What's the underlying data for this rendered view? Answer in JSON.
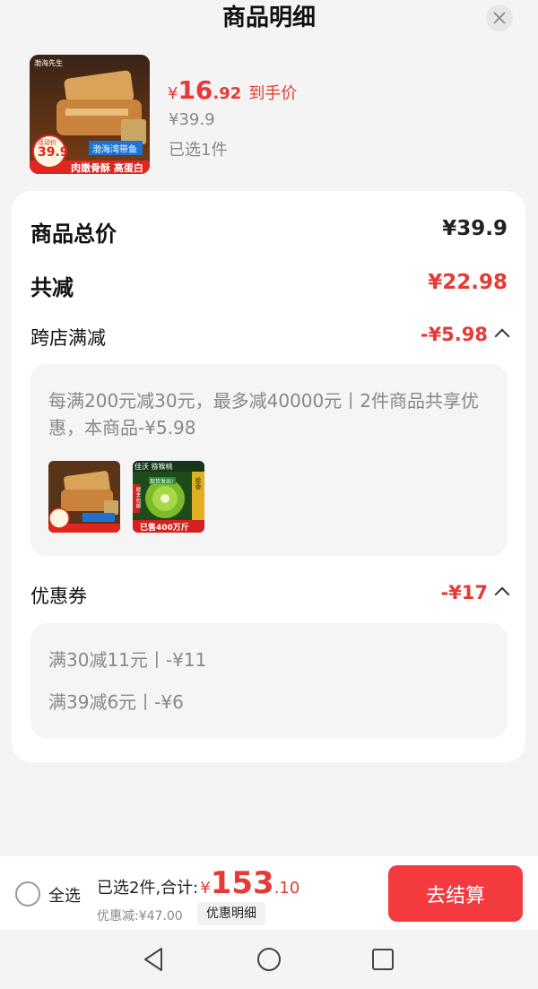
{
  "header": {
    "title": "商品明细"
  },
  "product": {
    "price_currency": "¥",
    "price_int": "16",
    "price_dec": ".92",
    "price_tag": "到手价",
    "original_price": "¥39.9",
    "selected_count": "已选1件",
    "thumb_texts": {
      "brand": "渤海先生",
      "badge_top": "活动价",
      "badge_price": "39.9",
      "fish_label": "渤海湾带鱼",
      "ribbon": "肉嫩骨酥 高蛋白"
    }
  },
  "details": {
    "total_label": "商品总价",
    "total_value": "¥39.9",
    "reduce_label": "共减",
    "reduce_value": "¥22.98",
    "cross_store": {
      "label": "跨店满减",
      "value": "-¥5.98",
      "desc": "每满200元减30元，最多减40000元丨2件商品共享优惠，本商品-¥5.98",
      "kiwi_texts": {
        "top": "佳沃 猕猴桃",
        "sticker": "现货发出!",
        "side_left": "顺丰包邮",
        "side_right": "徐香",
        "sold": "已售400万斤"
      }
    },
    "coupon": {
      "label": "优惠券",
      "value": "-¥17",
      "items": [
        "满30减11元丨-¥11",
        "满39减6元丨-¥6"
      ]
    }
  },
  "bottom": {
    "select_all": "全选",
    "summary_label": "已选2件,合计:",
    "sum_currency": "¥",
    "sum_int": "153",
    "sum_dec": ".10",
    "discount_text": "优惠减:¥47.00",
    "detail_button": "优惠明细",
    "checkout_button": "去结算"
  },
  "colors": {
    "accent": "#e53a35",
    "checkout": "#f23a3f"
  }
}
